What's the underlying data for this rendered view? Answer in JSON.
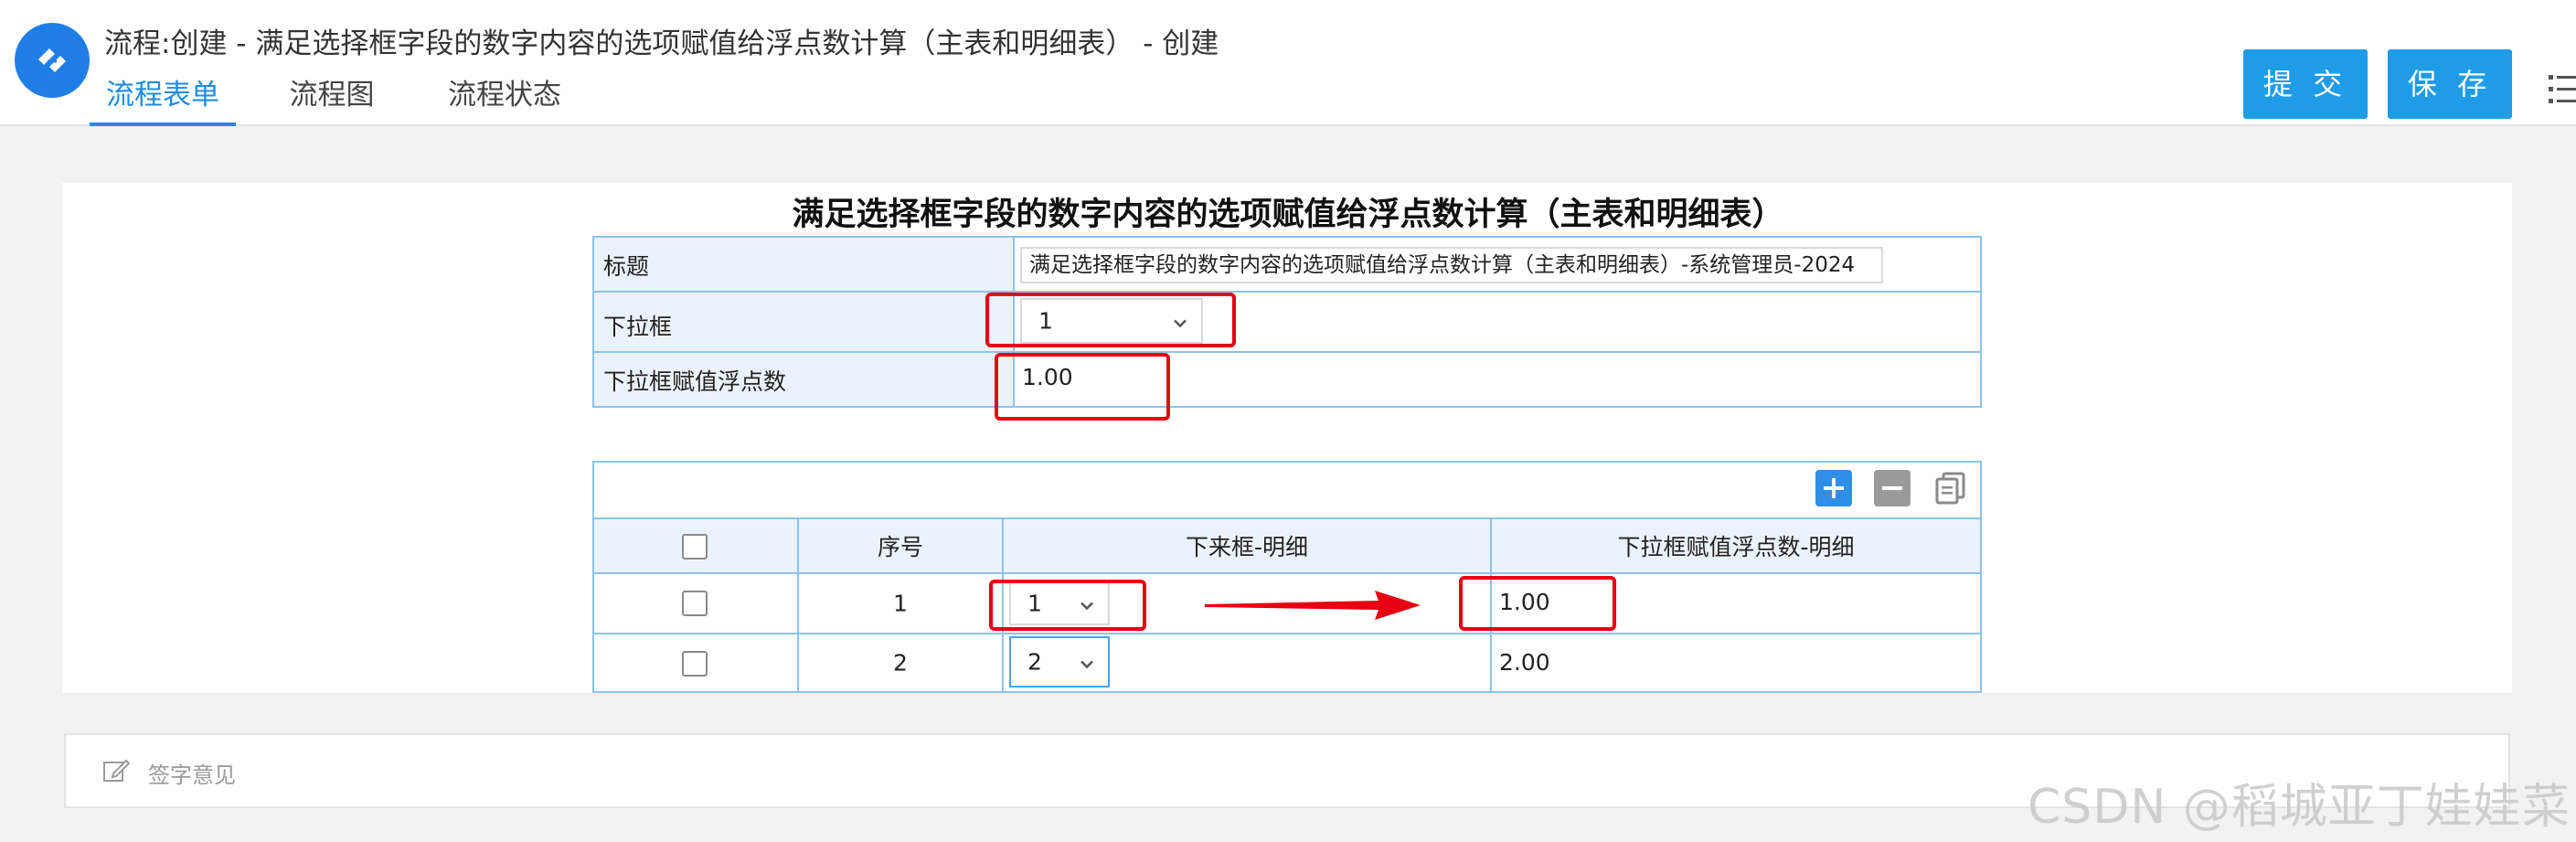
{
  "header": {
    "title": "流程:创建 - 满足选择框字段的数字内容的选项赋值给浮点数计算（主表和明细表） - 创建",
    "logo_icon": "workflow-logo-icon",
    "tabs": [
      {
        "label": "流程表单",
        "active": true
      },
      {
        "label": "流程图",
        "active": false
      },
      {
        "label": "流程状态",
        "active": false
      }
    ],
    "buttons": {
      "submit": "提 交",
      "save": "保 存"
    },
    "menu_icon": "list-menu-icon",
    "accent_color": "#1e9ce8"
  },
  "form": {
    "title": "满足选择框字段的数字内容的选项赋值给浮点数计算（主表和明细表）",
    "fields": {
      "title_label": "标题",
      "title_value": "满足选择框字段的数字内容的选项赋值给浮点数计算（主表和明细表）-系统管理员-2024",
      "select_label": "下拉框",
      "select_value": "1",
      "float_label": "下拉框赋值浮点数",
      "float_value": "1.00"
    }
  },
  "detail": {
    "toolbar": {
      "add_icon": "plus-icon",
      "remove_icon": "minus-icon",
      "copy_icon": "copy-icon"
    },
    "columns": [
      "序号",
      "下来框-明细",
      "下拉框赋值浮点数-明细"
    ],
    "rows": [
      {
        "index": "1",
        "select": "1",
        "float": "1.00"
      },
      {
        "index": "2",
        "select": "2",
        "float": "2.00"
      }
    ]
  },
  "signature": {
    "label": "签字意见",
    "icon": "edit-icon"
  },
  "annotation_color": "#e60012",
  "watermark": "CSDN @稻城亚丁娃娃菜"
}
